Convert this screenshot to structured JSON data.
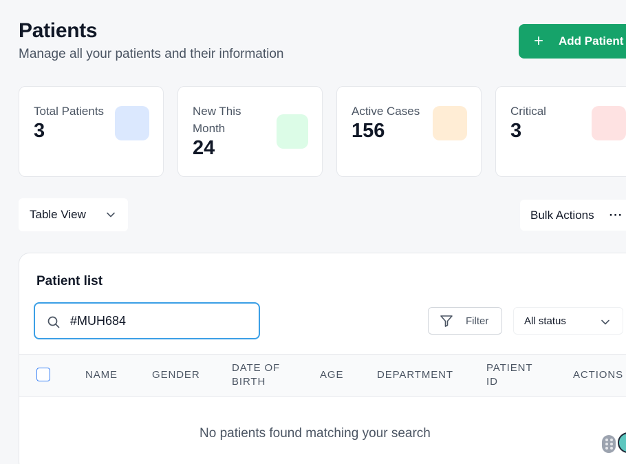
{
  "header": {
    "title": "Patients",
    "subtitle": "Manage all your patients and their information",
    "add_button_label": "Add Patient",
    "add_button_icon": "plus-icon"
  },
  "stats": [
    {
      "label": "Total Patients",
      "value": "3",
      "icon_color": "#dbe8fe"
    },
    {
      "label": "New This Month",
      "value": "24",
      "icon_color": "#dcfce7"
    },
    {
      "label": "Active Cases",
      "value": "156",
      "icon_color": "#ffedd5"
    },
    {
      "label": "Critical",
      "value": "3",
      "icon_color": "#fee2e2"
    }
  ],
  "toolbar": {
    "view_select_value": "Table View",
    "bulk_actions_label": "Bulk Actions",
    "bulk_actions_icon": "more-horizontal-icon"
  },
  "patient_list": {
    "title": "Patient list",
    "search_value": "#MUH684",
    "filter_label": "Filter",
    "status_select_value": "All status",
    "columns": [
      "NAME",
      "GENDER",
      "DATE OF BIRTH",
      "AGE",
      "DEPARTMENT",
      "PATIENT ID",
      "ACTIONS"
    ],
    "empty_message": "No patients found matching your search"
  },
  "colors": {
    "accent_green": "#16a36a",
    "focus_blue": "#3b9fe6",
    "checkbox_blue": "#3b82f6"
  }
}
